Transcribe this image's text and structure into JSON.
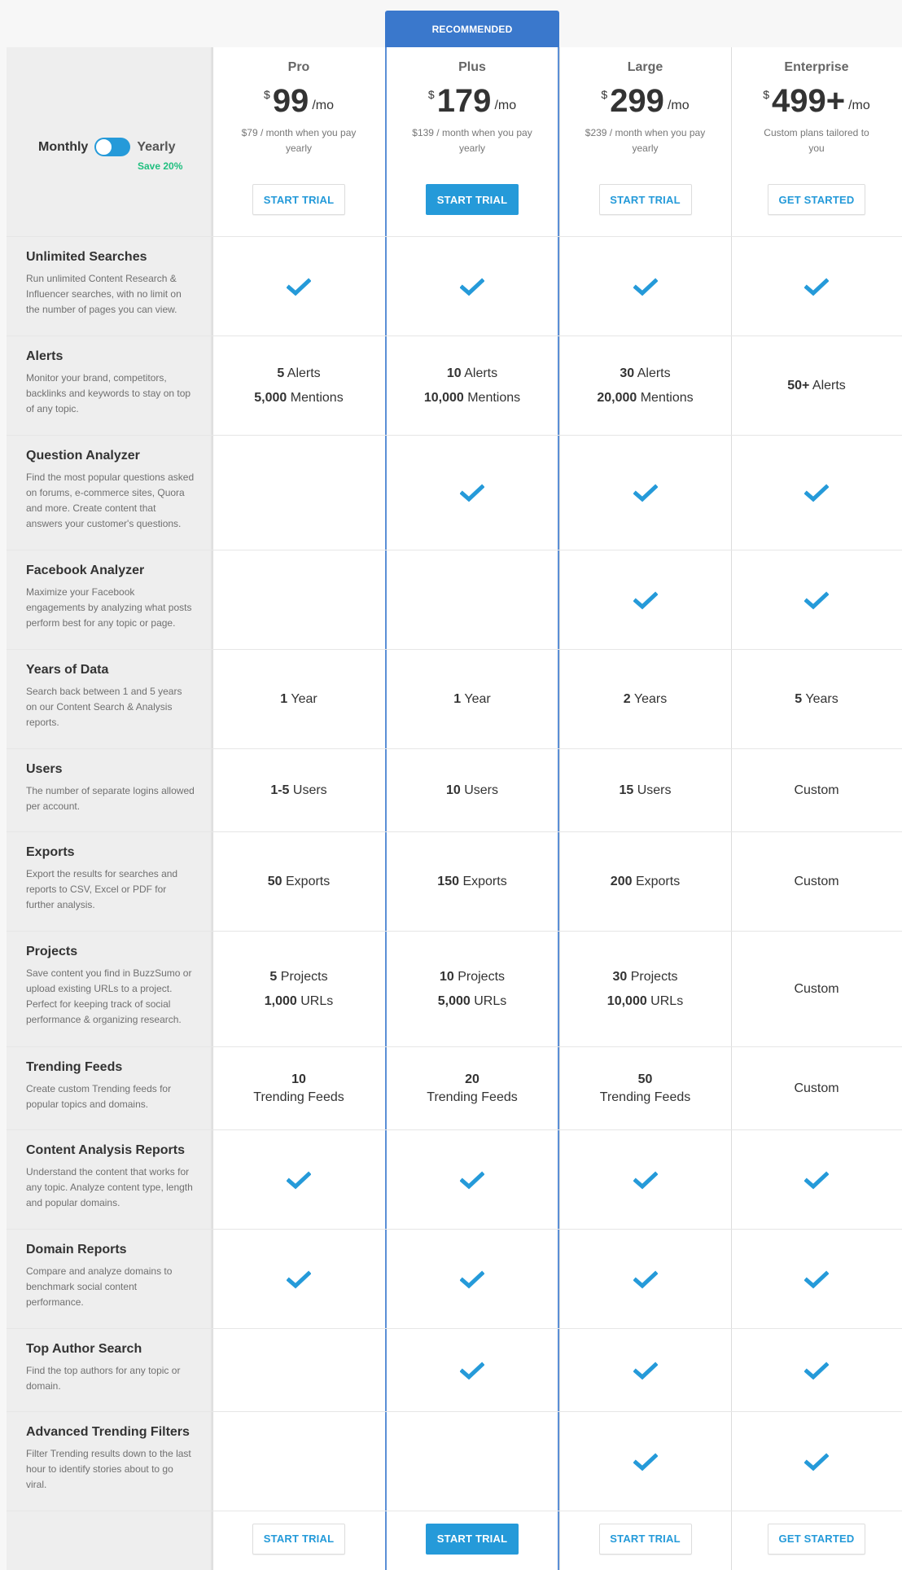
{
  "recommended_label": "RECOMMENDED",
  "billing_toggle": {
    "left_label": "Monthly",
    "right_label": "Yearly",
    "selected": "Yearly",
    "savings_note": "Save 20%"
  },
  "plans": [
    {
      "name": "Pro",
      "currency": "$",
      "price": "99",
      "period": "/mo",
      "note": "$79 / month when you pay yearly",
      "cta": "START TRIAL",
      "cta_style": "outline"
    },
    {
      "name": "Plus",
      "currency": "$",
      "price": "179",
      "period": "/mo",
      "note": "$139 / month when you pay yearly",
      "cta": "START TRIAL",
      "cta_style": "solid",
      "recommended": true
    },
    {
      "name": "Large",
      "currency": "$",
      "price": "299",
      "period": "/mo",
      "note": "$239 / month when you pay yearly",
      "cta": "START TRIAL",
      "cta_style": "outline"
    },
    {
      "name": "Enterprise",
      "currency": "$",
      "price": "499+",
      "period": "/mo",
      "note": "Custom plans tailored to you",
      "cta": "GET STARTED",
      "cta_style": "outline"
    }
  ],
  "features": [
    {
      "title": "Unlimited Searches",
      "desc": "Run unlimited Content Research & Influencer searches, with no limit on the number of pages you can view.",
      "values": [
        {
          "check": true
        },
        {
          "check": true
        },
        {
          "check": true
        },
        {
          "check": true
        }
      ]
    },
    {
      "title": "Alerts",
      "desc": "Monitor your brand, competitors, backlinks and keywords to stay on top of any topic.",
      "values": [
        {
          "lines": [
            {
              "b": "5",
              "t": " Alerts"
            },
            {
              "b": "5,000",
              "t": " Mentions"
            }
          ]
        },
        {
          "lines": [
            {
              "b": "10",
              "t": " Alerts"
            },
            {
              "b": "10,000",
              "t": " Mentions"
            }
          ]
        },
        {
          "lines": [
            {
              "b": "30",
              "t": " Alerts"
            },
            {
              "b": "20,000",
              "t": " Mentions"
            }
          ]
        },
        {
          "lines": [
            {
              "b": "50+",
              "t": " Alerts"
            }
          ]
        }
      ]
    },
    {
      "title": "Question Analyzer",
      "desc": "Find the most popular questions asked on forums, e-commerce sites, Quora and more. Create content that answers your customer's questions.",
      "values": [
        {
          "check": false
        },
        {
          "check": true
        },
        {
          "check": true
        },
        {
          "check": true
        }
      ]
    },
    {
      "title": "Facebook Analyzer",
      "desc": "Maximize your Facebook engagements by analyzing what posts perform best for any topic or page.",
      "values": [
        {
          "check": false
        },
        {
          "check": false
        },
        {
          "check": true
        },
        {
          "check": true
        }
      ]
    },
    {
      "title": "Years of Data",
      "desc": "Search back between 1 and 5 years on our Content Search & Analysis reports.",
      "values": [
        {
          "lines": [
            {
              "b": "1",
              "t": " Year"
            }
          ]
        },
        {
          "lines": [
            {
              "b": "1",
              "t": " Year"
            }
          ]
        },
        {
          "lines": [
            {
              "b": "2",
              "t": " Years"
            }
          ]
        },
        {
          "lines": [
            {
              "b": "5",
              "t": " Years"
            }
          ]
        }
      ]
    },
    {
      "title": "Users",
      "desc": "The number of separate logins allowed per account.",
      "values": [
        {
          "lines": [
            {
              "b": "1-5",
              "t": " Users"
            }
          ]
        },
        {
          "lines": [
            {
              "b": "10",
              "t": " Users"
            }
          ]
        },
        {
          "lines": [
            {
              "b": "15",
              "t": " Users"
            }
          ]
        },
        {
          "lines": [
            {
              "b": "",
              "t": "Custom"
            }
          ]
        }
      ]
    },
    {
      "title": "Exports",
      "desc": "Export the results for searches and reports to CSV, Excel or PDF for further analysis.",
      "values": [
        {
          "lines": [
            {
              "b": "50",
              "t": " Exports"
            }
          ]
        },
        {
          "lines": [
            {
              "b": "150",
              "t": " Exports"
            }
          ]
        },
        {
          "lines": [
            {
              "b": "200",
              "t": " Exports"
            }
          ]
        },
        {
          "lines": [
            {
              "b": "",
              "t": "Custom"
            }
          ]
        }
      ]
    },
    {
      "title": "Projects",
      "desc": "Save content you find in BuzzSumo or upload existing URLs to a project. Perfect for keeping track of social performance & organizing research.",
      "values": [
        {
          "lines": [
            {
              "b": "5",
              "t": " Projects"
            },
            {
              "b": "1,000",
              "t": " URLs"
            }
          ]
        },
        {
          "lines": [
            {
              "b": "10",
              "t": " Projects"
            },
            {
              "b": "5,000",
              "t": " URLs"
            }
          ]
        },
        {
          "lines": [
            {
              "b": "30",
              "t": " Projects"
            },
            {
              "b": "10,000",
              "t": " URLs"
            }
          ]
        },
        {
          "lines": [
            {
              "b": "",
              "t": "Custom"
            }
          ]
        }
      ]
    },
    {
      "title": "Trending Feeds",
      "desc": "Create custom Trending feeds for popular topics and domains.",
      "values": [
        {
          "stack": {
            "b": "10",
            "t": "Trending Feeds"
          }
        },
        {
          "stack": {
            "b": "20",
            "t": "Trending Feeds"
          }
        },
        {
          "stack": {
            "b": "50",
            "t": "Trending Feeds"
          }
        },
        {
          "lines": [
            {
              "b": "",
              "t": "Custom"
            }
          ]
        }
      ]
    },
    {
      "title": "Content Analysis Reports",
      "desc": "Understand the content that works for any topic. Analyze content type, length and popular domains.",
      "values": [
        {
          "check": true
        },
        {
          "check": true
        },
        {
          "check": true
        },
        {
          "check": true
        }
      ]
    },
    {
      "title": "Domain Reports",
      "desc": "Compare and analyze domains to benchmark social content performance.",
      "values": [
        {
          "check": true
        },
        {
          "check": true
        },
        {
          "check": true
        },
        {
          "check": true
        }
      ]
    },
    {
      "title": "Top Author Search",
      "desc": "Find the top authors for any topic or domain.",
      "values": [
        {
          "check": false
        },
        {
          "check": true
        },
        {
          "check": true
        },
        {
          "check": true
        }
      ]
    },
    {
      "title": "Advanced Trending Filters",
      "desc": "Filter Trending results down to the last hour to identify stories about to go viral.",
      "values": [
        {
          "check": false
        },
        {
          "check": false
        },
        {
          "check": true
        },
        {
          "check": true
        }
      ]
    }
  ],
  "colors": {
    "accent": "#259ad9",
    "recommended": "#3a78cc",
    "savings": "#1fbf7f",
    "feature_bg": "#eeeeee"
  }
}
